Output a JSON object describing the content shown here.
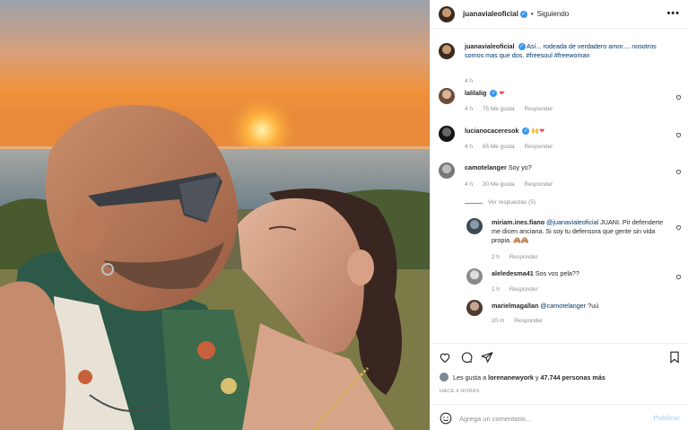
{
  "post": {
    "username": "juanavialeoficial",
    "follow_status": "Siguiendo",
    "more_label": "•••",
    "verified_mark": "✓"
  },
  "caption": {
    "username": "juanavialeoficial",
    "text_before": "Así... rodeada de verdadero amor.... nosotros somos mas que dos.",
    "hashtag1": "#freesoul",
    "hashtag2": "#freewoman",
    "time": "4 h"
  },
  "comments": [
    {
      "username": "lalilalig",
      "text": "",
      "emoji": "❤",
      "time": "4 h",
      "likes": "75 Me gusta",
      "reply": "Responder"
    },
    {
      "username": "lucianocaceresok",
      "text": "",
      "emoji": "🙌❤",
      "time": "4 h",
      "likes": "65 Me gusta",
      "reply": "Responder"
    },
    {
      "username": "camotelanger",
      "text": "Soy yo?",
      "time": "4 h",
      "likes": "30 Me gusta",
      "reply": "Responder"
    }
  ],
  "view_replies": "Ver respuestas (5)",
  "replies": [
    {
      "username": "miriam.ines.fiano",
      "mention": "@juanavialeoficial",
      "text": "JUANI. Pir defenderte me dicen anciana. Si soy tu defensora que gente sin vida propia. 🙈🙈",
      "time": "2 h",
      "reply": "Responder"
    },
    {
      "username": "aleledesma41",
      "text": "Sos vos pela??",
      "time": "1 h",
      "reply": "Responder"
    },
    {
      "username": "marielmagallan",
      "mention": "@camotelanger",
      "text": "?uú",
      "time": "20 m",
      "reply": "Responder"
    }
  ],
  "likes": {
    "prefix": "Les gusta a",
    "user": "lorenanewyork",
    "conj": "y",
    "count": "47.744 personas más"
  },
  "posted_ago": "HACE 4 HORAS",
  "composer": {
    "placeholder": "Agrega un comentario...",
    "publish_label": "Publicar"
  },
  "colors": {
    "verified": "#3897f0",
    "link": "#00376b",
    "muted": "#8e8e8e",
    "heart": "#ed4956",
    "publish": "#b3dbff"
  },
  "icons": [
    "heart-icon",
    "comment-icon",
    "share-icon",
    "bookmark-icon",
    "emoji-icon"
  ]
}
